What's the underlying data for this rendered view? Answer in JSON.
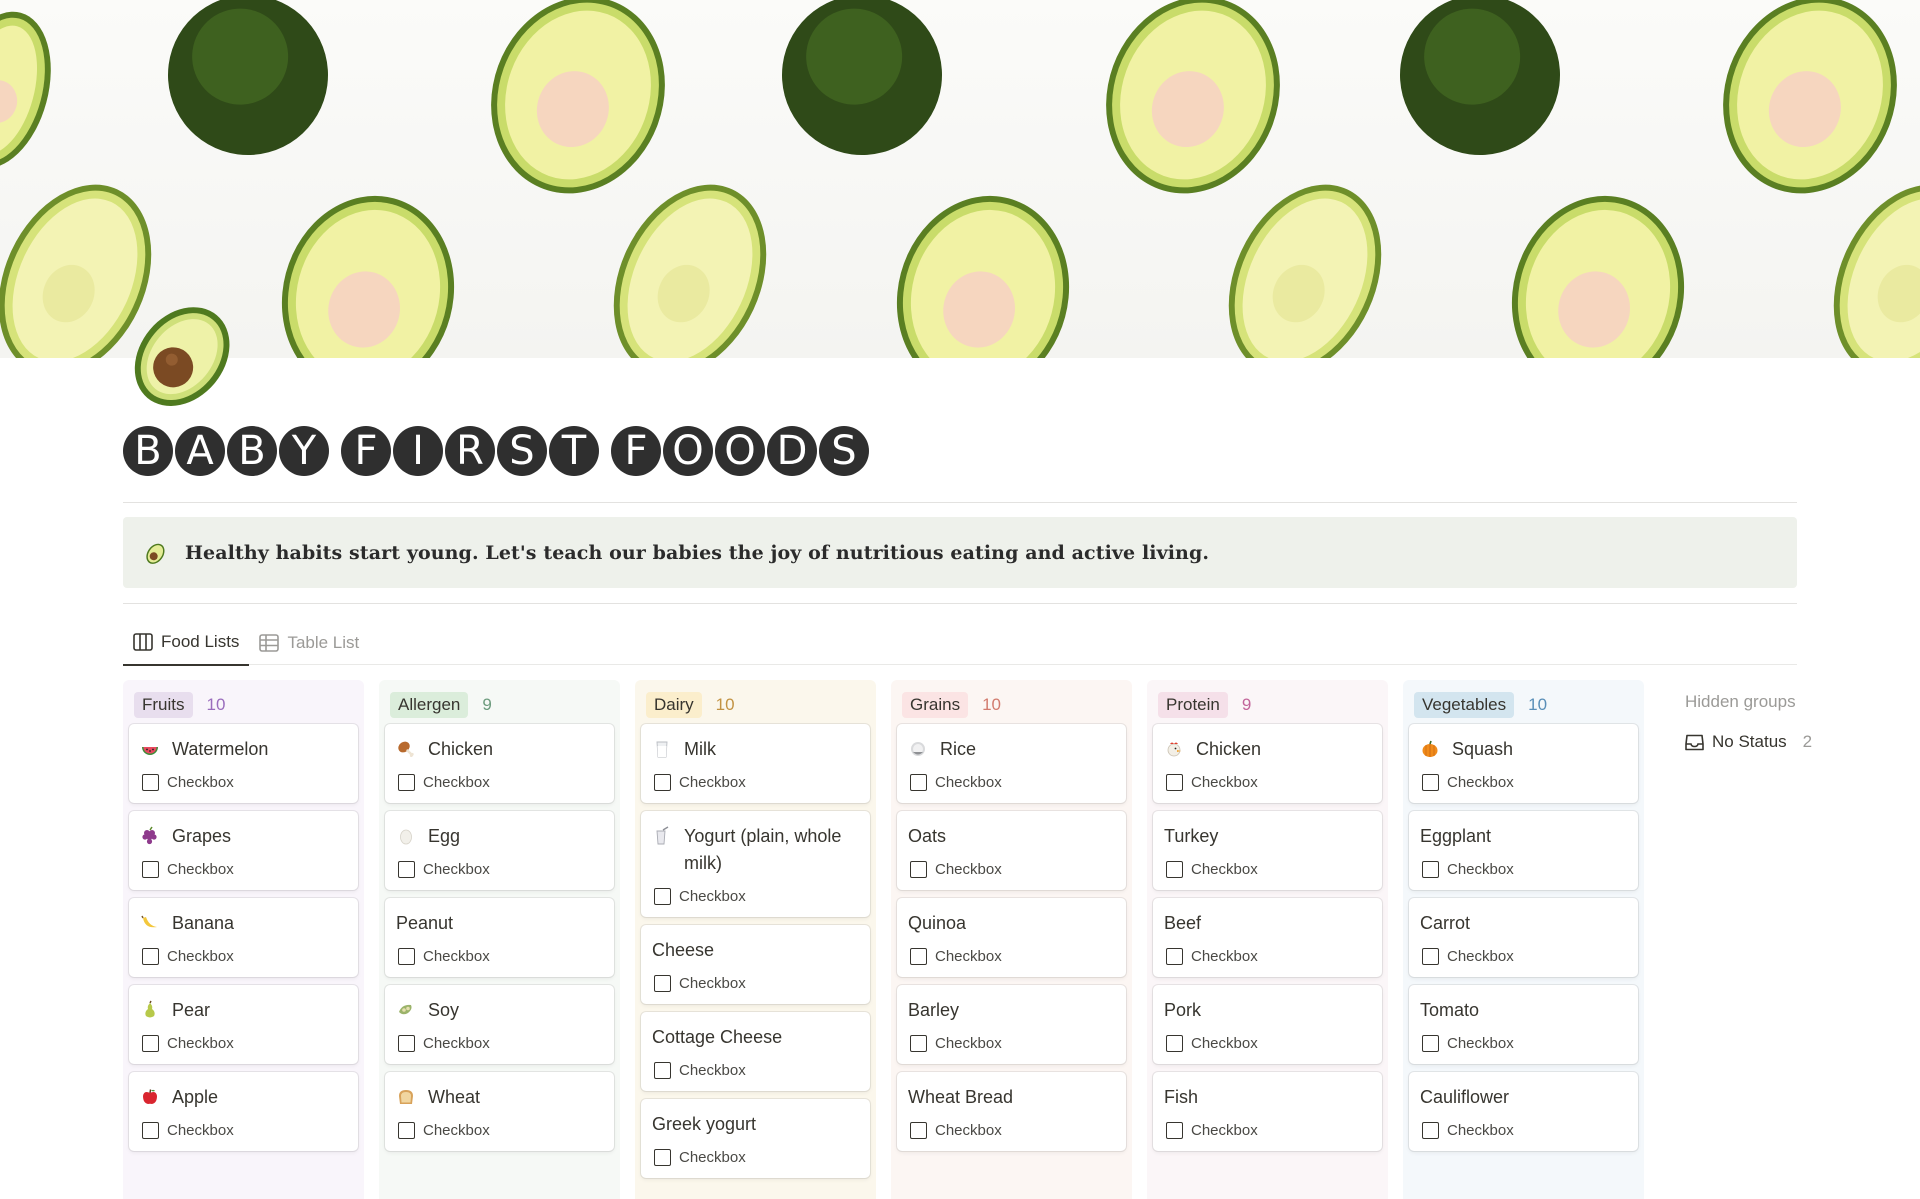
{
  "title": {
    "words": [
      [
        "B",
        "A",
        "B",
        "Y"
      ],
      [
        "F",
        "I",
        "R",
        "S",
        "T"
      ],
      [
        "F",
        "O",
        "O",
        "D",
        "S"
      ]
    ]
  },
  "callout": {
    "icon": "avocado-emoji",
    "text": "Healthy habits start young. Let's teach our babies the joy of nutritious eating and active living."
  },
  "tabs": [
    {
      "label": "Food Lists",
      "icon": "board-icon",
      "active": true
    },
    {
      "label": "Table List",
      "icon": "table-icon",
      "active": false
    }
  ],
  "columns": [
    {
      "name": "Fruits",
      "count": "10",
      "colors": {
        "bg": "#f9f5fb",
        "tag": "#e8deee",
        "count": "#9a6dbd"
      },
      "cards": [
        {
          "title": "Watermelon",
          "emoji": "watermelon",
          "check": "Checkbox"
        },
        {
          "title": "Grapes",
          "emoji": "grapes",
          "check": "Checkbox"
        },
        {
          "title": "Banana",
          "emoji": "banana",
          "check": "Checkbox"
        },
        {
          "title": "Pear",
          "emoji": "pear",
          "check": "Checkbox"
        },
        {
          "title": "Apple",
          "emoji": "apple",
          "check": "Checkbox"
        }
      ]
    },
    {
      "name": "Allergen",
      "count": "9",
      "colors": {
        "bg": "#f6f9f6",
        "tag": "#dbeddb",
        "count": "#6c9b7d"
      },
      "cards": [
        {
          "title": "Chicken",
          "emoji": "drumstick",
          "check": "Checkbox"
        },
        {
          "title": "Egg",
          "emoji": "egg",
          "check": "Checkbox"
        },
        {
          "title": "Peanut",
          "emoji": "",
          "check": "Checkbox"
        },
        {
          "title": "Soy",
          "emoji": "soybean",
          "check": "Checkbox"
        },
        {
          "title": "Wheat",
          "emoji": "bread",
          "check": "Checkbox"
        }
      ]
    },
    {
      "name": "Dairy",
      "count": "10",
      "colors": {
        "bg": "#fbf7ec",
        "tag": "#fbeecc",
        "count": "#c29343"
      },
      "cards": [
        {
          "title": "Milk",
          "emoji": "milk-glass",
          "check": "Checkbox"
        },
        {
          "title": "Yogurt (plain, whole milk)",
          "emoji": "yogurt",
          "check": "Checkbox"
        },
        {
          "title": "Cheese",
          "emoji": "",
          "check": "Checkbox"
        },
        {
          "title": "Cottage Cheese",
          "emoji": "",
          "check": "Checkbox"
        },
        {
          "title": "Greek yogurt",
          "emoji": "",
          "check": "Checkbox"
        }
      ]
    },
    {
      "name": "Grains",
      "count": "10",
      "colors": {
        "bg": "#fcf6f3",
        "tag": "#fbe4e4",
        "count": "#d27b6e"
      },
      "cards": [
        {
          "title": "Rice",
          "emoji": "rice-ball",
          "check": "Checkbox"
        },
        {
          "title": "Oats",
          "emoji": "",
          "check": "Checkbox"
        },
        {
          "title": "Quinoa",
          "emoji": "",
          "check": "Checkbox"
        },
        {
          "title": "Barley",
          "emoji": "",
          "check": "Checkbox"
        },
        {
          "title": "Wheat Bread",
          "emoji": "",
          "check": "Checkbox"
        }
      ]
    },
    {
      "name": "Protein",
      "count": "9",
      "colors": {
        "bg": "#fbf6f8",
        "tag": "#f5e0e9",
        "count": "#c2659a"
      },
      "cards": [
        {
          "title": "Chicken",
          "emoji": "chicken",
          "check": "Checkbox"
        },
        {
          "title": "Turkey",
          "emoji": "",
          "check": "Checkbox"
        },
        {
          "title": "Beef",
          "emoji": "",
          "check": "Checkbox"
        },
        {
          "title": "Pork",
          "emoji": "",
          "check": "Checkbox"
        },
        {
          "title": "Fish",
          "emoji": "",
          "check": "Checkbox"
        }
      ]
    },
    {
      "name": "Vegetables",
      "count": "10",
      "colors": {
        "bg": "#f4f8fb",
        "tag": "#d3e5ef",
        "count": "#5a8fb8"
      },
      "cards": [
        {
          "title": "Squash",
          "emoji": "squash",
          "check": "Checkbox"
        },
        {
          "title": "Eggplant",
          "emoji": "",
          "check": "Checkbox"
        },
        {
          "title": "Carrot",
          "emoji": "",
          "check": "Checkbox"
        },
        {
          "title": "Tomato",
          "emoji": "",
          "check": "Checkbox"
        },
        {
          "title": "Cauliflower",
          "emoji": "",
          "check": "Checkbox"
        }
      ]
    }
  ],
  "hidden_groups": {
    "title": "Hidden groups",
    "items": [
      {
        "label": "No Status",
        "count": "2",
        "icon": "inbox-icon"
      }
    ]
  }
}
